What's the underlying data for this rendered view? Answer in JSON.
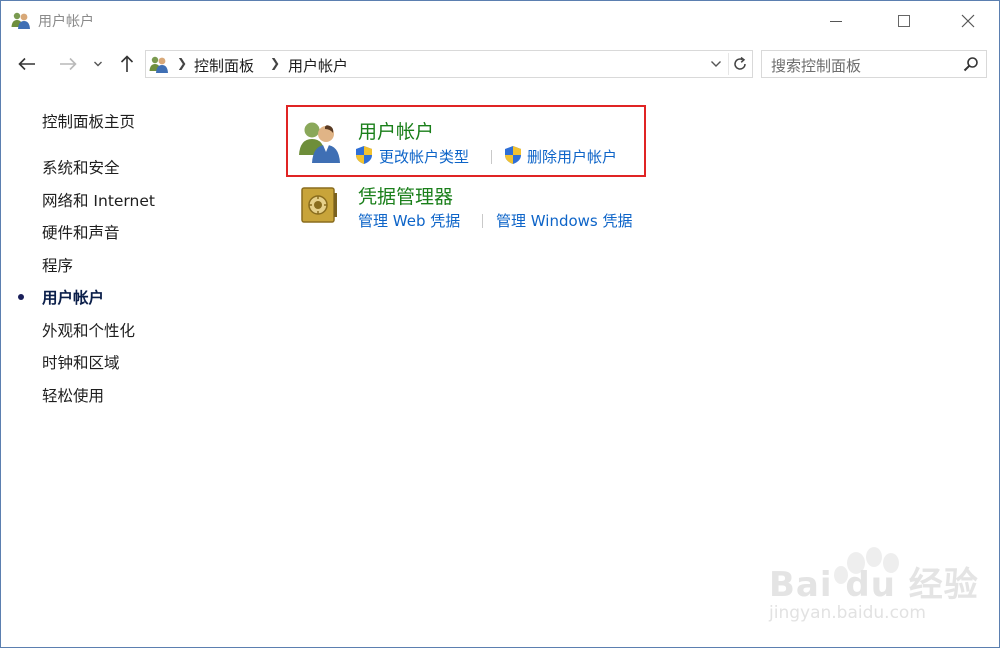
{
  "window": {
    "title": "用户帐户"
  },
  "address": {
    "crumbs": [
      "控制面板",
      "用户帐户"
    ]
  },
  "search": {
    "placeholder": "搜索控制面板"
  },
  "sidebar": {
    "home": "控制面板主页",
    "items": [
      {
        "label": "系统和安全",
        "active": false
      },
      {
        "label": "网络和 Internet",
        "active": false
      },
      {
        "label": "硬件和声音",
        "active": false
      },
      {
        "label": "程序",
        "active": false
      },
      {
        "label": "用户帐户",
        "active": true
      },
      {
        "label": "外观和个性化",
        "active": false
      },
      {
        "label": "时钟和区域",
        "active": false
      },
      {
        "label": "轻松使用",
        "active": false
      }
    ]
  },
  "categories": [
    {
      "title": "用户帐户",
      "icon": "users-icon",
      "links": [
        "更改帐户类型",
        "删除用户帐户"
      ]
    },
    {
      "title": "凭据管理器",
      "icon": "vault-icon",
      "links": [
        "管理 Web 凭据",
        "管理 Windows 凭据"
      ]
    }
  ],
  "colors": {
    "category_title": "#1a7f1a",
    "link": "#0d64c8",
    "highlight": "#e02424"
  },
  "watermark": {
    "brand": "Bai du 经验",
    "url": "jingyan.baidu.com"
  }
}
